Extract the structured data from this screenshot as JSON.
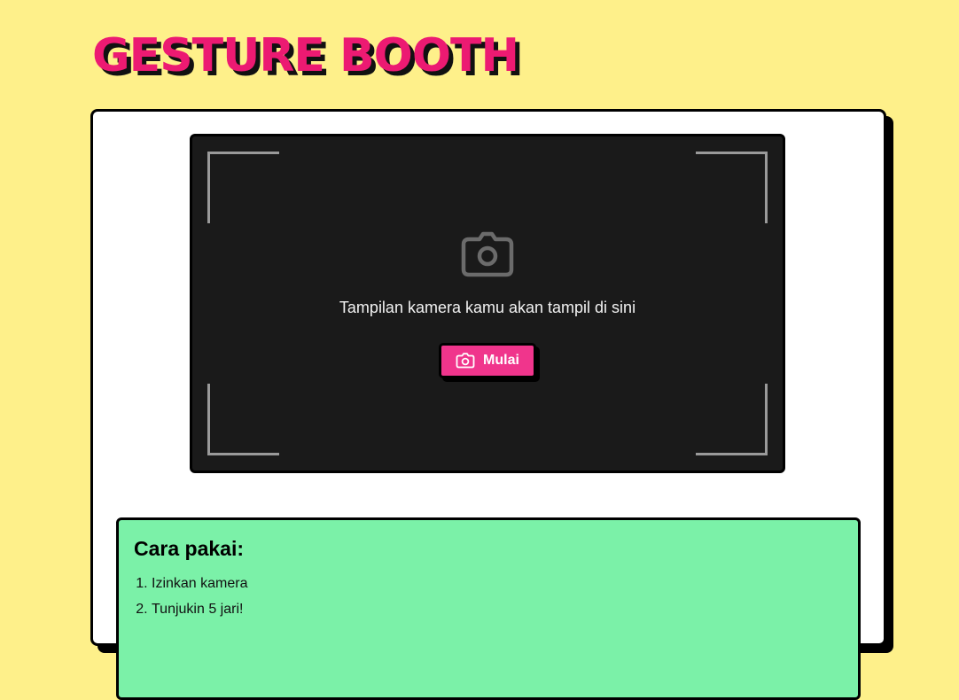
{
  "header": {
    "title": "GESTURE BOOTH"
  },
  "camera": {
    "placeholder_icon": "camera-icon",
    "placeholder_text": "Tampilan kamera kamu akan tampil di sini",
    "start_button": {
      "icon": "camera-icon",
      "label": "Mulai"
    }
  },
  "instructions": {
    "heading": "Cara pakai:",
    "steps": [
      "Izinkan kamera",
      "Tunjukin 5 jari!"
    ]
  },
  "colors": {
    "page_background": "#fef08a",
    "accent_pink": "#ec1a72",
    "button_pink": "#f0358c",
    "camera_background": "#1a1a1a",
    "instructions_background": "#7bf1a8"
  }
}
